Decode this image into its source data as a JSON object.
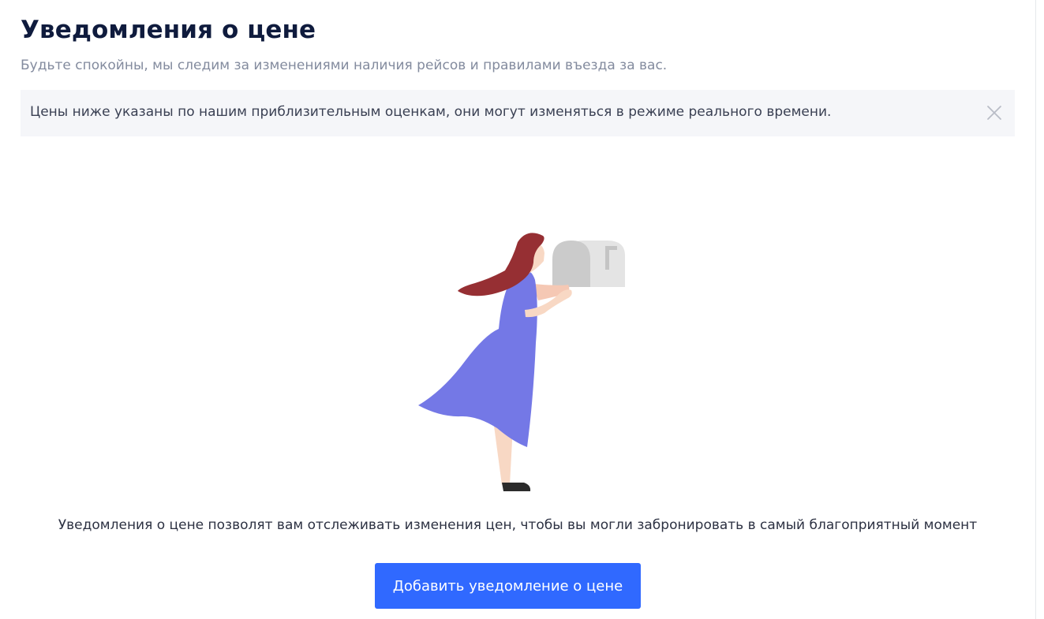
{
  "header": {
    "title": "Уведомления о цене",
    "subtitle": "Будьте спокойны, мы следим за изменениями наличия рейсов и правилами въезда за вас."
  },
  "notice": {
    "text": "Цены ниже указаны по нашим приблизительным оценкам, они могут изменяться в режиме реального времени.",
    "close_icon": "close-icon"
  },
  "empty_state": {
    "illustration": "woman-with-mailbox-illustration",
    "description": "Уведомления о цене позволят вам отслеживать изменения цен, чтобы вы могли забронировать в самый благоприятный момент",
    "button_label": "Добавить уведомление о цене"
  },
  "colors": {
    "primary": "#3069ff",
    "title": "#0f1b3d",
    "muted": "#838b9e",
    "notice_bg": "#f5f6f9",
    "dress": "#7478e6",
    "hair": "#962f33"
  }
}
